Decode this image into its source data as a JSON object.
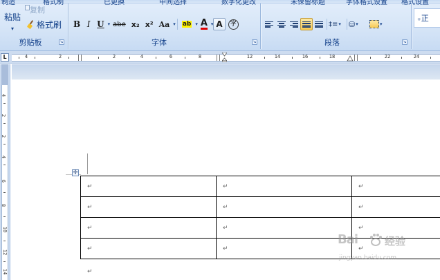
{
  "ribbon": {
    "cut_labels": [
      "制造",
      "格式制",
      "已更换",
      "中间选择",
      "数字化更改",
      "未保留标题",
      "字体格式设置",
      "格式设置"
    ],
    "clipboard": {
      "paste_label": "粘贴",
      "copy_label": "复制",
      "format_painter_label": "格式刷",
      "group_label": "剪贴板"
    },
    "font": {
      "group_label": "字体",
      "bold": "B",
      "italic": "I",
      "underline": "U",
      "strikethrough": "abe",
      "subscript": "x₂",
      "superscript": "x²",
      "change_case": "Aa",
      "highlight": "ab",
      "font_color": "A",
      "char_shading": "A",
      "enclose_char": "字"
    },
    "paragraph": {
      "group_label": "段落",
      "line_spacing": "‡≡"
    },
    "styles": {
      "quick_style": "₊正"
    }
  },
  "ruler": {
    "tab_selector": "L",
    "numbers": [
      "4",
      "2",
      "2",
      "4",
      "6",
      "8",
      "12",
      "14",
      "16",
      "18",
      "22",
      "24"
    ],
    "vertical_numbers": [
      "4",
      "2",
      "2",
      "4",
      "6",
      "8",
      "10",
      "12",
      "14"
    ]
  },
  "document": {
    "table": {
      "rows": [
        [
          "↵",
          "↵",
          "↵"
        ],
        [
          "↵",
          "↵",
          "↵"
        ],
        [
          "↵",
          "↵",
          "↵"
        ],
        [
          "↵",
          "↵",
          "↵"
        ]
      ]
    },
    "after_table_mark": "↵",
    "move_handle": "✛"
  },
  "watermark": {
    "logo": "Bai",
    "text": "经验",
    "url": "jingyan.baidu.com"
  },
  "colors": {
    "ribbon_text": "#15428b",
    "highlight": "#fff200",
    "font_color_bar": "#e00000",
    "active_button": "#f7c955"
  }
}
